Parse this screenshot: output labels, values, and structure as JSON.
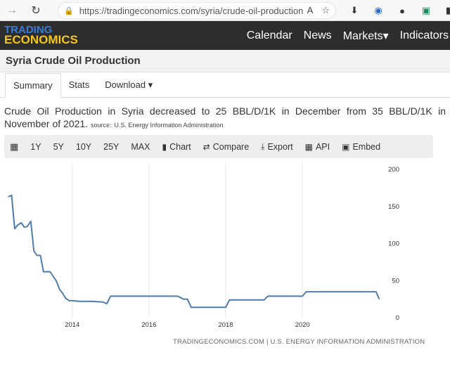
{
  "browser": {
    "url": "https://tradingeconomics.com/syria/crude-oil-production"
  },
  "header": {
    "logo_top": "TRADING",
    "logo_bottom": "ECONOMICS",
    "nav": [
      "Calendar",
      "News",
      "Markets▾",
      "Indicators"
    ]
  },
  "page": {
    "title": "Syria Crude Oil Production",
    "tabs": [
      "Summary",
      "Stats",
      "Download ▾"
    ],
    "description": "Crude Oil Production in Syria decreased to 25 BBL/D/1K in December from 35 BBL/D/1K in November of 2021.",
    "source_label": "source:",
    "source": "U.S. Energy Information Administration"
  },
  "toolbar": {
    "items": [
      "1Y",
      "5Y",
      "10Y",
      "25Y",
      "MAX",
      "Chart",
      "Compare",
      "Export",
      "API",
      "Embed"
    ]
  },
  "chart_data": {
    "type": "line",
    "x_ticks": [
      "2014",
      "2016",
      "2018",
      "2020"
    ],
    "y_ticks": [
      0,
      50,
      100,
      150,
      200
    ],
    "ylim": [
      0,
      200
    ],
    "xlim": [
      2012.3,
      2022.05
    ],
    "grid": "vertical",
    "color": "#4f7cad",
    "series": [
      {
        "x": [
          2012.33,
          2012.42,
          2012.5,
          2012.58,
          2012.67,
          2012.75,
          2012.83,
          2012.92,
          2013.0,
          2013.08,
          2013.17,
          2013.25,
          2013.33,
          2013.42,
          2013.5,
          2013.58,
          2013.67,
          2013.75,
          2013.83,
          2013.92,
          2014.0,
          2014.2,
          2014.5,
          2014.8,
          2014.9,
          2015.0,
          2015.5,
          2016.0,
          2016.5,
          2016.75,
          2016.9,
          2017.0,
          2017.1,
          2017.5,
          2017.9,
          2018.0,
          2018.1,
          2018.5,
          2018.9,
          2019.0,
          2019.1,
          2019.5,
          2019.9,
          2020.0,
          2020.1,
          2020.5,
          2021.0,
          2021.5,
          2021.83,
          2021.92,
          2022.0
        ],
        "y": [
          163,
          165,
          120,
          125,
          128,
          122,
          123,
          130,
          90,
          84,
          84,
          62,
          62,
          62,
          56,
          50,
          38,
          33,
          26,
          23,
          23,
          22,
          22,
          21,
          19,
          29,
          29,
          29,
          29,
          29,
          25,
          25,
          14,
          14,
          14,
          14,
          24,
          24,
          24,
          24,
          29,
          29,
          29,
          29,
          35,
          35,
          35,
          35,
          35,
          35,
          25
        ]
      }
    ],
    "credit": "TRADINGECONOMICS.COM | U.S. ENERGY INFORMATION ADMINISTRATION"
  }
}
